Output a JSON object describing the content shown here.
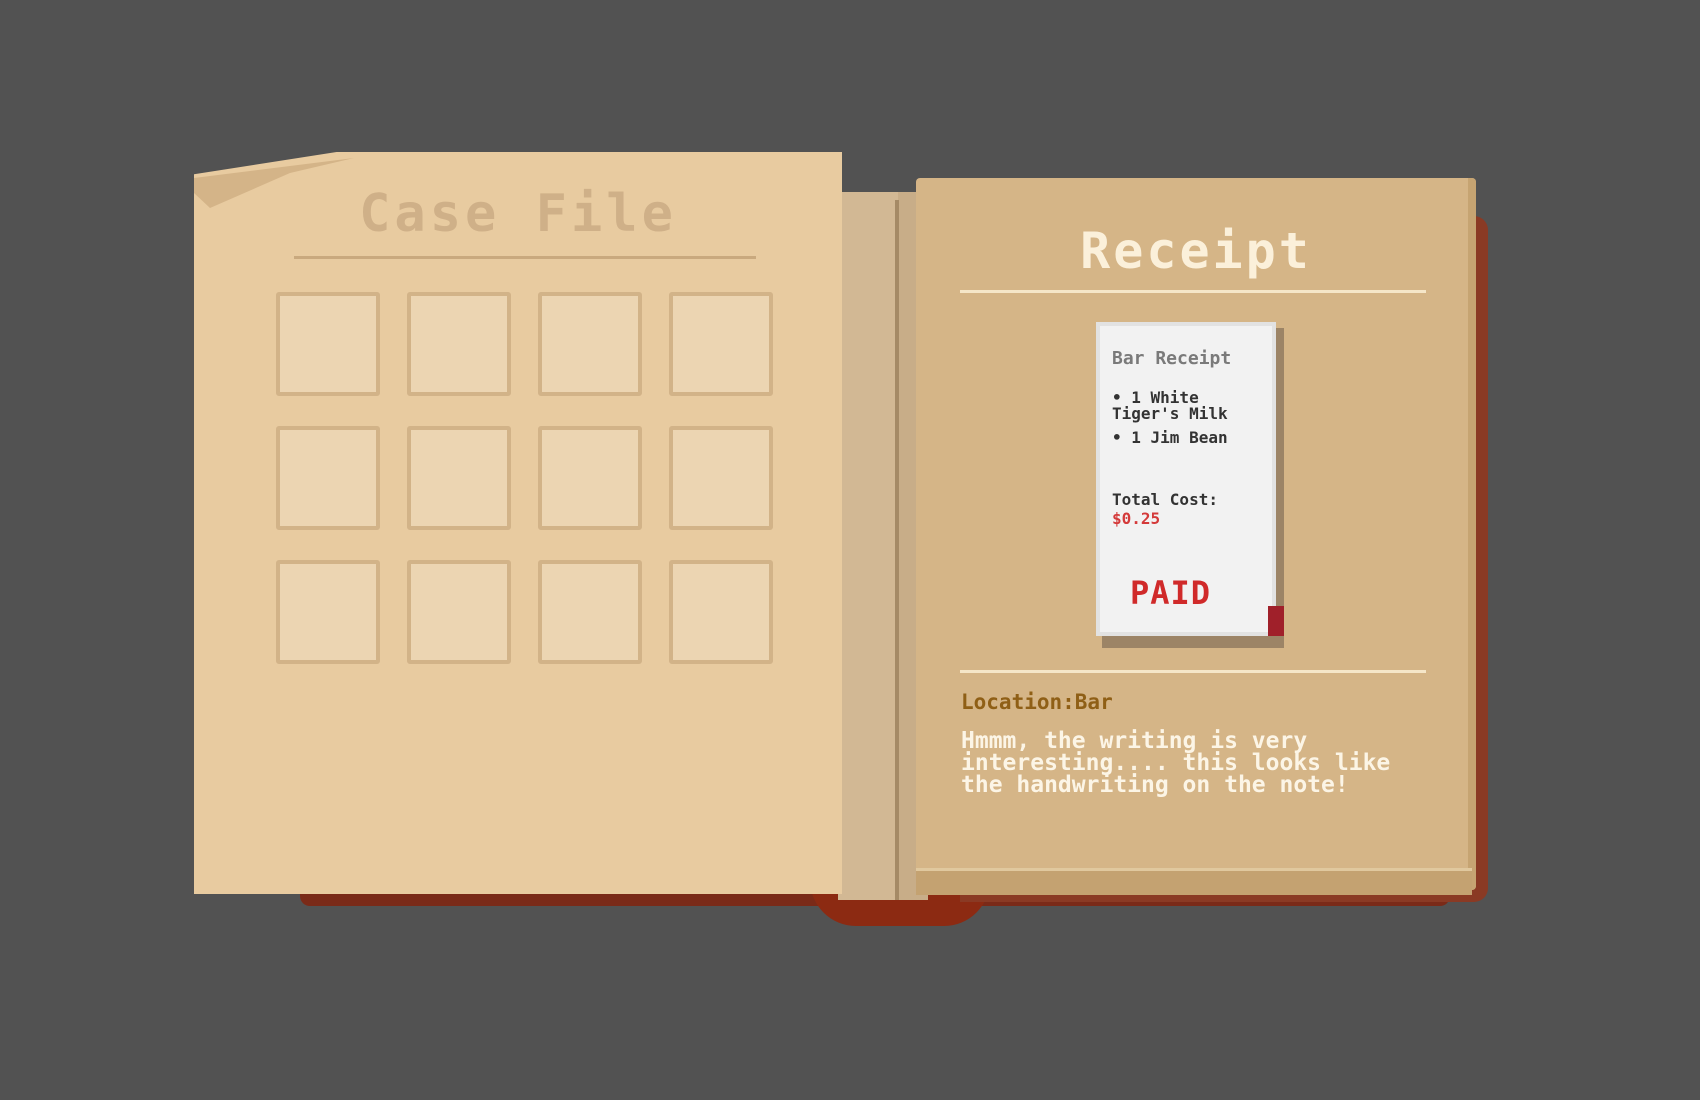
{
  "left_page": {
    "title": "Case File",
    "evidence_slots": 12
  },
  "right_page": {
    "title": "Receipt",
    "receipt": {
      "name": "Bar Receipt",
      "items": [
        "• 1 White Tiger's Milk",
        "• 1 Jim Bean"
      ],
      "total_label": "Total Cost:",
      "total_value": "$0.25",
      "stamp": "PAID"
    },
    "location": "Location:Bar",
    "description": "Hmmm, the writing is very interesting.... this looks like the handwriting on the note!"
  },
  "colors": {
    "background": "#525252",
    "left_page": "#e8cba0",
    "right_page": "#d5b587",
    "stamp_red": "#d02a2a"
  }
}
